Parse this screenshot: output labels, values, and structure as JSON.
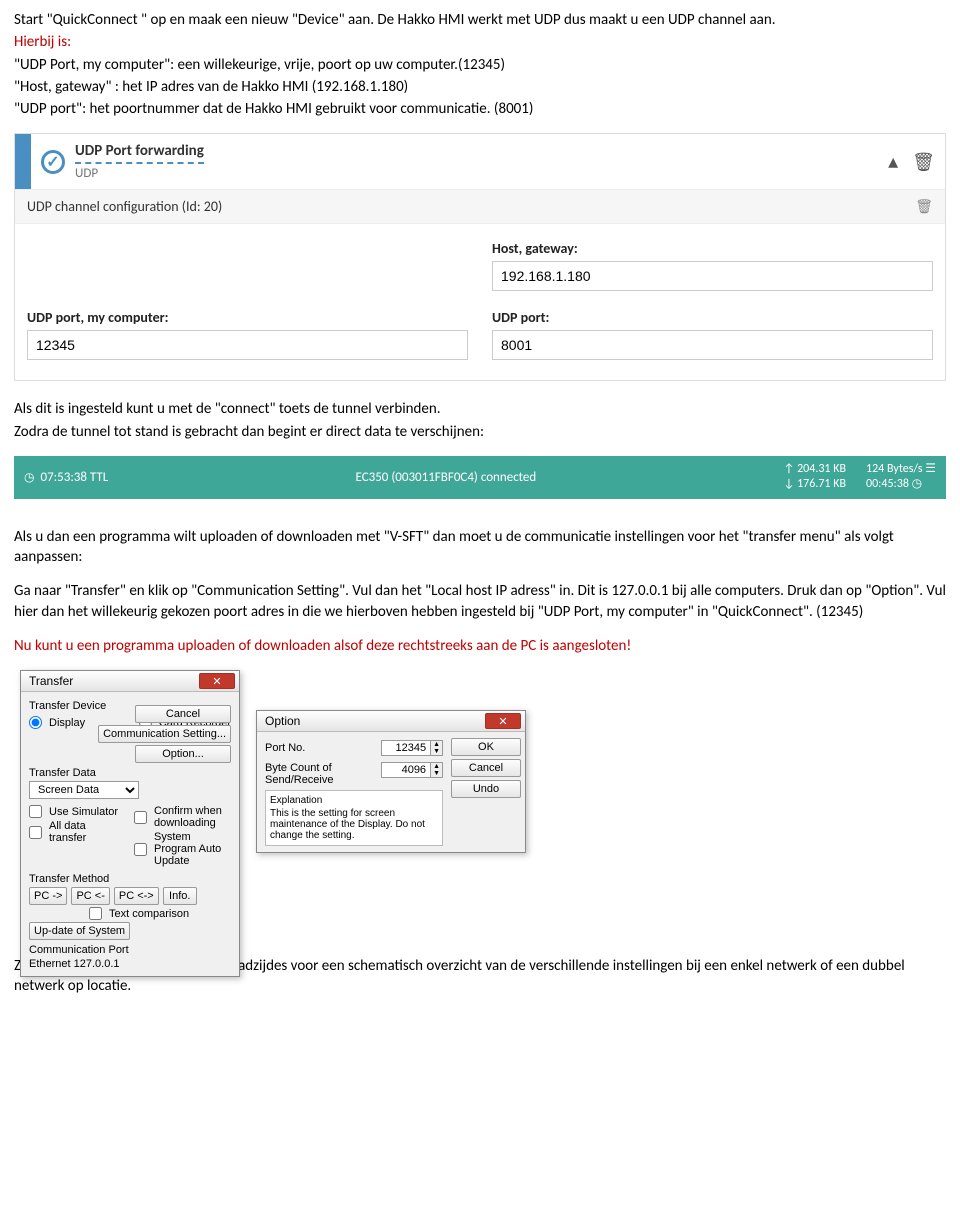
{
  "doc": {
    "p1": "Start \"QuickConnect \" op en maak een nieuw \"Device\" aan. De Hakko HMI werkt met UDP dus maakt u een UDP channel aan.",
    "p2": "Hierbij is:",
    "p3": "\"UDP Port, my computer\": een willekeurige, vrije, poort op uw computer.(12345)",
    "p4": "\"Host, gateway\" : het IP adres van de Hakko HMI (192.168.1.180)",
    "p5": "\"UDP port\": het poortnummer dat de Hakko HMI gebruikt voor communicatie. (8001)",
    "p6": "Als dit is ingesteld kunt u met de \"connect\" toets de tunnel verbinden.",
    "p7": "Zodra de tunnel tot stand is gebracht dan begint er direct data te verschijnen:",
    "p8": "Als u dan een programma wilt uploaden of downloaden met \"V-SFT\" dan moet u de communicatie instellingen voor het \"transfer menu\" als volgt aanpassen:",
    "p9": "Ga naar \"Transfer\" en klik op \"Communication Setting\". Vul dan het \"Local host IP adress\" in. Dit is 127.0.0.1 bij alle computers. Druk dan op \"Option\". Vul hier dan het willekeurig gekozen poort adres in die we hierboven hebben ingesteld bij \"UDP Port, my computer\" in \"QuickConnect\". (12345)",
    "p10": "Nu kunt u een programma uploaden of downloaden alsof deze rechtstreeks aan de PC is aangesloten!",
    "p11": "Zie ter verduidelijking de volgende bladzijdes voor een schematisch overzicht van de verschillende  instellingen bij een enkel netwerk of een dubbel netwerk op locatie."
  },
  "ss1": {
    "title": "UDP Port forwarding",
    "subtitle": "UDP",
    "channel": "UDP channel configuration (Id: 20)",
    "host_label": "Host, gateway:",
    "host_value": "192.168.1.180",
    "udpport_my_label": "UDP port, my computer:",
    "udpport_my_value": "12345",
    "udpport_label": "UDP port:",
    "udpport_value": "8001"
  },
  "ss2": {
    "ttl": "07:53:38 TTL",
    "device": "EC350 (003011FBF0C4) connected",
    "up_kb": "204.31 KB",
    "down_kb": "176.71 KB",
    "bytes": "124 Bytes/s",
    "elapsed": "00:45:38"
  },
  "ss3": {
    "transfer": {
      "title": "Transfer",
      "transfer_device": "Transfer Device",
      "display": "Display",
      "card_recorder": "Card Recorder",
      "cancel": "Cancel",
      "comm_setting": "Communication Setting...",
      "option": "Option...",
      "transfer_data": "Transfer Data",
      "screen_data": "Screen Data",
      "use_simulator": "Use Simulator",
      "all_data_transfer": "All data transfer",
      "confirm_dl": "Confirm when downloading",
      "sys_auto_update": "System Program Auto Update",
      "transfer_method": "Transfer Method",
      "pc_to": "PC ->",
      "pc_from": "PC <-",
      "pc_both": "PC <->",
      "info": "Info.",
      "text_compare": "Text comparison",
      "update_system": "Up-date of System",
      "comm_port_label": "Communication Port",
      "comm_port_value": "Ethernet 127.0.0.1"
    },
    "option": {
      "title": "Option",
      "port_no_label": "Port No.",
      "port_no_value": "12345",
      "byte_label": "Byte Count of Send/Receive",
      "byte_value": "4096",
      "ok": "OK",
      "cancel": "Cancel",
      "undo": "Undo",
      "explain_title": "Explanation",
      "explain_body": "This is the setting for screen maintenance of the Display. Do not change the setting."
    }
  }
}
